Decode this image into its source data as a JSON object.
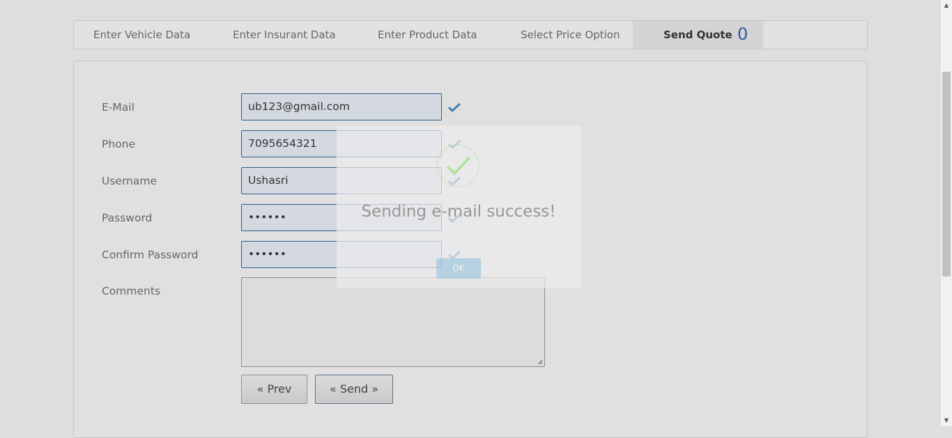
{
  "tabs": [
    {
      "label": "Enter Vehicle Data"
    },
    {
      "label": "Enter Insurant Data"
    },
    {
      "label": "Enter Product Data"
    },
    {
      "label": "Select Price Option"
    },
    {
      "label": "Send Quote",
      "count": "0",
      "active": true
    }
  ],
  "form": {
    "email": {
      "label": "E-Mail",
      "value": "ub123@gmail.com"
    },
    "phone": {
      "label": "Phone",
      "value": "7095654321"
    },
    "username": {
      "label": "Username",
      "value": "Ushasri"
    },
    "password": {
      "label": "Password",
      "value": "••••••"
    },
    "confirm_password": {
      "label": "Confirm Password",
      "value": "••••••"
    },
    "comments": {
      "label": "Comments",
      "value": ""
    }
  },
  "buttons": {
    "prev": "« Prev",
    "send": "« Send »"
  },
  "modal": {
    "title": "Sending e-mail success!",
    "ok": "OK"
  },
  "colors": {
    "accent": "#2d5aa6",
    "check": "#3f7fb0",
    "success": "#a5dc86"
  }
}
